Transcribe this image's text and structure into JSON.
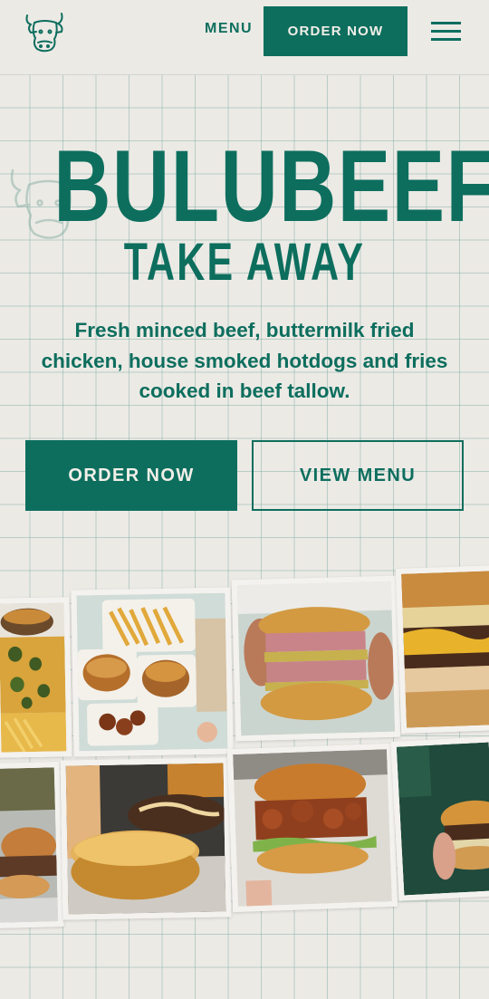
{
  "header": {
    "logo_icon": "cow-head-icon",
    "menu_label": "MENU",
    "order_label": "ORDER NOW",
    "hamburger_icon": "hamburger-menu-icon"
  },
  "hero": {
    "title": "BULUBEEF",
    "subtitle": "TAKE AWAY",
    "tagline": "Fresh minced beef, buttermilk fried chicken, house smoked hotdogs and fries cooked in beef tallow.",
    "primary_cta": "ORDER NOW",
    "secondary_cta": "VIEW MENU"
  },
  "gallery": {
    "photos": [
      "burger-with-jalapenos-photo",
      "takeaway-spread-photo",
      "stacked-smash-burger-photo",
      "cheeseburger-closeup-photo",
      "burger-sandwich-edge-photo",
      "sesame-bun-photo",
      "fried-chicken-burger-photo",
      "hand-holding-burger-photo"
    ]
  },
  "colors": {
    "brand_green": "#0d6e5e",
    "background": "#eceae5",
    "button_text": "#f2efe8"
  }
}
